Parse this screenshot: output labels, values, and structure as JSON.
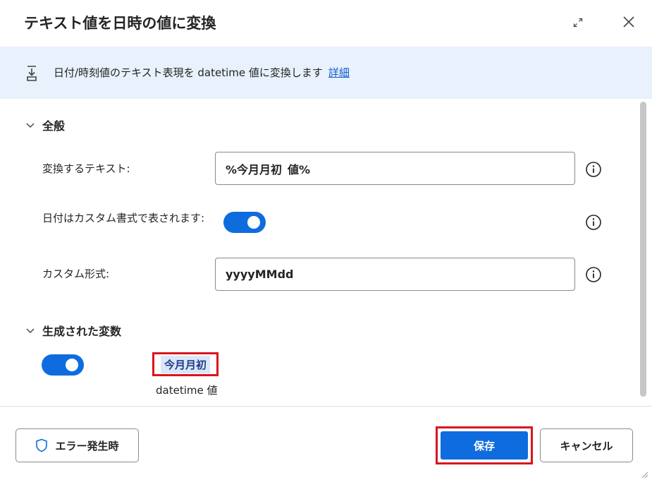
{
  "dialog": {
    "title": "テキスト値を日時の値に変換",
    "expand_icon": "expand-diagonal-icon",
    "close_icon": "close-icon"
  },
  "banner": {
    "icon": "convert-down-icon",
    "text": "日付/時刻値のテキスト表現を datetime 値に変換します",
    "link_label": "詳細",
    "background": "#e8f1fc",
    "link_color": "#0f5bd1"
  },
  "general": {
    "section_label": "全般",
    "text_to_convert": {
      "label": "変換するテキスト:",
      "value": "%今月月初_値%"
    },
    "custom_format_toggle": {
      "label": "日付はカスタム書式で表されます:",
      "state": "on"
    },
    "custom_format": {
      "label": "カスタム形式:",
      "value": "yyyyMMdd"
    }
  },
  "variables": {
    "section_label": "生成された変数",
    "toggle_state": "on",
    "variable_name": "今月月初",
    "variable_type": "datetime 値"
  },
  "footer": {
    "error_button_label": "エラー発生時",
    "error_button_icon": "shield-icon",
    "save_label": "保存",
    "cancel_label": "キャンセル"
  },
  "colors": {
    "accent": "#0f6cde",
    "highlight_border": "#d9151f",
    "chip_background": "#dbe7f7",
    "chip_text": "#1d3c8c"
  }
}
